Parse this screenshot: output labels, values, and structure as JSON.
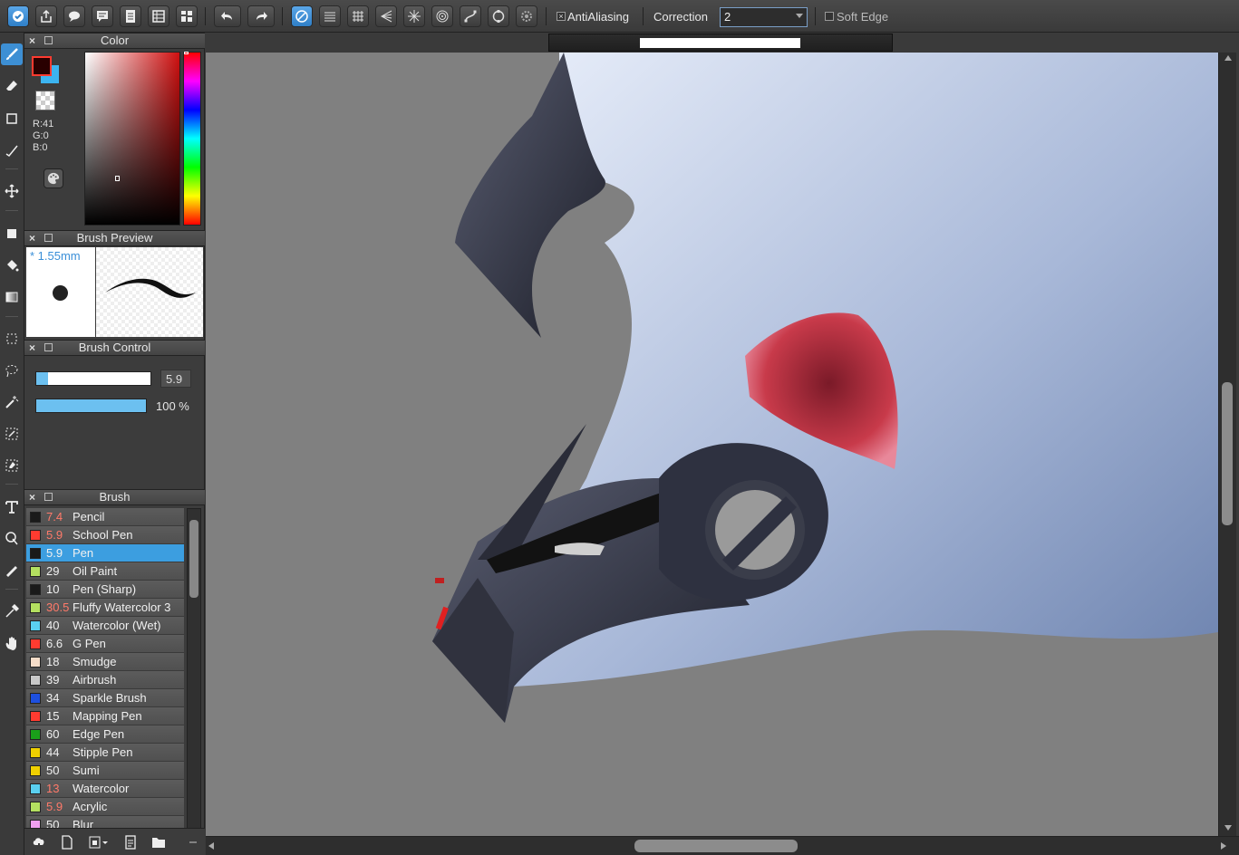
{
  "toolbar": {
    "antialiasing_label": "AntiAliasing",
    "antialiasing_mark": "×",
    "correction_label": "Correction",
    "correction_value": "2",
    "soft_edge_label": "Soft Edge"
  },
  "panels": {
    "color": {
      "title": "Color",
      "foreground_color": "#290000",
      "background_color": "#3cb4f0",
      "r_label": "R:41",
      "g_label": "G:0",
      "b_label": "B:0"
    },
    "brush_preview": {
      "title": "Brush Preview",
      "size": "* 1.55mm"
    },
    "brush_control": {
      "title": "Brush Control",
      "size_value": "5.9",
      "size_fraction": 0.1,
      "opacity_label": "100 %",
      "opacity_fraction": 1.0
    },
    "brush": {
      "title": "Brush",
      "items": [
        {
          "size": "7.4",
          "name": "Pencil",
          "swatch": "#1a1a1a",
          "size_color": "red",
          "selected": false
        },
        {
          "size": "5.9",
          "name": "School Pen",
          "swatch": "#ff3b30",
          "size_color": "red",
          "selected": false
        },
        {
          "size": "5.9",
          "name": "Pen",
          "swatch": "#1a1a1a",
          "size_color": "red",
          "selected": true
        },
        {
          "size": "29",
          "name": "Oil Paint",
          "swatch": "#b4e060",
          "size_color": "white",
          "selected": false
        },
        {
          "size": "10",
          "name": "Pen (Sharp)",
          "swatch": "#1a1a1a",
          "size_color": "white",
          "selected": false
        },
        {
          "size": "30.5",
          "name": "Fluffy Watercolor 3",
          "swatch": "#b4e060",
          "size_color": "red",
          "selected": false
        },
        {
          "size": "40",
          "name": "Watercolor (Wet)",
          "swatch": "#5ad0f0",
          "size_color": "white",
          "selected": false
        },
        {
          "size": "6.6",
          "name": "G Pen",
          "swatch": "#ff3b30",
          "size_color": "white",
          "selected": false
        },
        {
          "size": "18",
          "name": "Smudge",
          "swatch": "#f5dcc8",
          "size_color": "white",
          "selected": false
        },
        {
          "size": "39",
          "name": "Airbrush",
          "swatch": "#c8c8c8",
          "size_color": "white",
          "selected": false
        },
        {
          "size": "34",
          "name": "Sparkle Brush",
          "swatch": "#1e50e0",
          "size_color": "white",
          "selected": false
        },
        {
          "size": "15",
          "name": "Mapping Pen",
          "swatch": "#ff3b30",
          "size_color": "white",
          "selected": false
        },
        {
          "size": "60",
          "name": "Edge Pen",
          "swatch": "#1aa01a",
          "size_color": "white",
          "selected": false
        },
        {
          "size": "44",
          "name": "Stipple Pen",
          "swatch": "#f0d000",
          "size_color": "white",
          "selected": false
        },
        {
          "size": "50",
          "name": "Sumi",
          "swatch": "#f0d000",
          "size_color": "white",
          "selected": false
        },
        {
          "size": "13",
          "name": "Watercolor",
          "swatch": "#5ad0f0",
          "size_color": "red",
          "selected": false
        },
        {
          "size": "5.9",
          "name": "Acrylic",
          "swatch": "#b4e060",
          "size_color": "red",
          "selected": false
        },
        {
          "size": "50",
          "name": "Blur",
          "swatch": "#f0a0f0",
          "size_color": "white",
          "selected": false
        }
      ]
    }
  },
  "icons": {
    "toolbar": [
      "app-menu-icon",
      "export-icon",
      "chat-icon",
      "comment-icon",
      "document-icon",
      "layout-icon",
      "grid-layout-icon",
      "undo-icon",
      "redo-icon",
      "snap-off-icon",
      "parallel-snap-icon",
      "grid-snap-icon",
      "perspective-snap-icon",
      "radial-snap-icon",
      "concentric-snap-icon",
      "curve-snap-icon",
      "ellipse-snap-icon",
      "snap-settings-icon"
    ],
    "tools": [
      "brush-icon",
      "eraser-icon",
      "rectangle-icon",
      "pen-curve-icon",
      "move-icon",
      "fill-rect-icon",
      "bucket-icon",
      "gradient-icon",
      "select-rect-icon",
      "lasso-icon",
      "magic-wand-icon",
      "select-pen-icon",
      "select-eraser-icon",
      "text-icon",
      "operation-icon",
      "divide-icon",
      "eyedropper-icon",
      "hand-icon"
    ]
  },
  "status": {
    "canvas_background": "#808080",
    "accent": "#3c9ee0"
  }
}
